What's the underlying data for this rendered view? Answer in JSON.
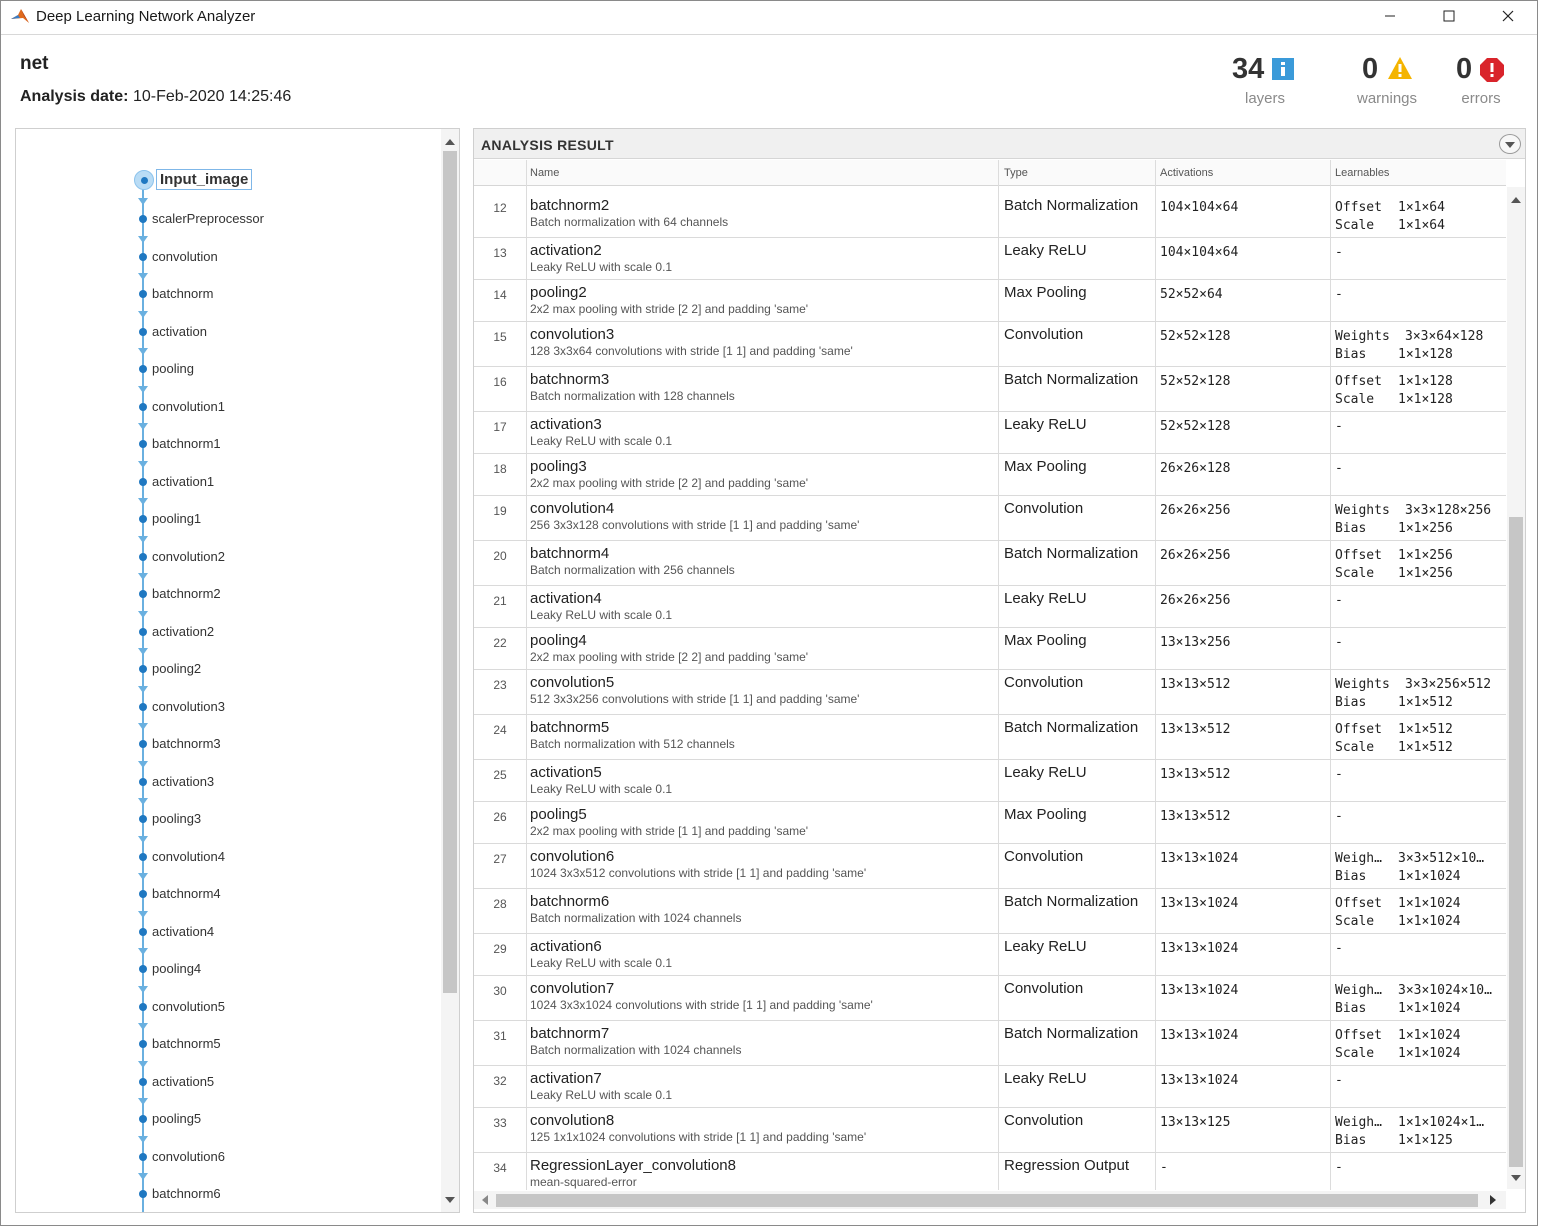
{
  "window": {
    "title": "Deep Learning Network Analyzer",
    "accent": "#1f78c1"
  },
  "header": {
    "network_name": "net",
    "analysis_date_label": "Analysis date:",
    "analysis_date_value": "10-Feb-2020 14:25:46",
    "layers_count": "34",
    "layers_label": "layers",
    "warnings_count": "0",
    "warnings_label": "warnings",
    "errors_count": "0",
    "errors_label": "errors"
  },
  "graph": {
    "root": "Input_image",
    "nodes": [
      "scalerPreprocessor",
      "convolution",
      "batchnorm",
      "activation",
      "pooling",
      "convolution1",
      "batchnorm1",
      "activation1",
      "pooling1",
      "convolution2",
      "batchnorm2",
      "activation2",
      "pooling2",
      "convolution3",
      "batchnorm3",
      "activation3",
      "pooling3",
      "convolution4",
      "batchnorm4",
      "activation4",
      "pooling4",
      "convolution5",
      "batchnorm5",
      "activation5",
      "pooling5",
      "convolution6",
      "batchnorm6"
    ]
  },
  "results": {
    "title": "ANALYSIS RESULT",
    "columns": {
      "name": "Name",
      "type": "Type",
      "activations": "Activations",
      "learnables": "Learnables"
    },
    "rows": [
      {
        "n": "12",
        "name": "batchnorm2",
        "desc": "Batch normalization with 64 channels",
        "type": "Batch Normalization",
        "act": "104×104×64",
        "learn": [
          [
            "Offset",
            "1×1×64"
          ],
          [
            "Scale",
            "1×1×64"
          ]
        ]
      },
      {
        "n": "13",
        "name": "activation2",
        "desc": "Leaky ReLU with scale 0.1",
        "type": "Leaky ReLU",
        "act": "104×104×64",
        "learn": [
          [
            "-",
            ""
          ]
        ]
      },
      {
        "n": "14",
        "name": "pooling2",
        "desc": "2x2 max pooling with stride [2 2] and padding 'same'",
        "type": "Max Pooling",
        "act": "52×52×64",
        "learn": [
          [
            "-",
            ""
          ]
        ]
      },
      {
        "n": "15",
        "name": "convolution3",
        "desc": "128 3x3x64 convolutions with stride [1 1] and padding 'same'",
        "type": "Convolution",
        "act": "52×52×128",
        "learn": [
          [
            "Weights",
            "3×3×64×128"
          ],
          [
            "Bias",
            "1×1×128"
          ]
        ]
      },
      {
        "n": "16",
        "name": "batchnorm3",
        "desc": "Batch normalization with 128 channels",
        "type": "Batch Normalization",
        "act": "52×52×128",
        "learn": [
          [
            "Offset",
            "1×1×128"
          ],
          [
            "Scale",
            "1×1×128"
          ]
        ]
      },
      {
        "n": "17",
        "name": "activation3",
        "desc": "Leaky ReLU with scale 0.1",
        "type": "Leaky ReLU",
        "act": "52×52×128",
        "learn": [
          [
            "-",
            ""
          ]
        ]
      },
      {
        "n": "18",
        "name": "pooling3",
        "desc": "2x2 max pooling with stride [2 2] and padding 'same'",
        "type": "Max Pooling",
        "act": "26×26×128",
        "learn": [
          [
            "-",
            ""
          ]
        ]
      },
      {
        "n": "19",
        "name": "convolution4",
        "desc": "256 3x3x128 convolutions with stride [1 1] and padding 'same'",
        "type": "Convolution",
        "act": "26×26×256",
        "learn": [
          [
            "Weights",
            "3×3×128×256"
          ],
          [
            "Bias",
            "1×1×256"
          ]
        ]
      },
      {
        "n": "20",
        "name": "batchnorm4",
        "desc": "Batch normalization with 256 channels",
        "type": "Batch Normalization",
        "act": "26×26×256",
        "learn": [
          [
            "Offset",
            "1×1×256"
          ],
          [
            "Scale",
            "1×1×256"
          ]
        ]
      },
      {
        "n": "21",
        "name": "activation4",
        "desc": "Leaky ReLU with scale 0.1",
        "type": "Leaky ReLU",
        "act": "26×26×256",
        "learn": [
          [
            "-",
            ""
          ]
        ]
      },
      {
        "n": "22",
        "name": "pooling4",
        "desc": "2x2 max pooling with stride [2 2] and padding 'same'",
        "type": "Max Pooling",
        "act": "13×13×256",
        "learn": [
          [
            "-",
            ""
          ]
        ]
      },
      {
        "n": "23",
        "name": "convolution5",
        "desc": "512 3x3x256 convolutions with stride [1 1] and padding 'same'",
        "type": "Convolution",
        "act": "13×13×512",
        "learn": [
          [
            "Weights",
            "3×3×256×512"
          ],
          [
            "Bias",
            "1×1×512"
          ]
        ]
      },
      {
        "n": "24",
        "name": "batchnorm5",
        "desc": "Batch normalization with 512 channels",
        "type": "Batch Normalization",
        "act": "13×13×512",
        "learn": [
          [
            "Offset",
            "1×1×512"
          ],
          [
            "Scale",
            "1×1×512"
          ]
        ]
      },
      {
        "n": "25",
        "name": "activation5",
        "desc": "Leaky ReLU with scale 0.1",
        "type": "Leaky ReLU",
        "act": "13×13×512",
        "learn": [
          [
            "-",
            ""
          ]
        ]
      },
      {
        "n": "26",
        "name": "pooling5",
        "desc": "2x2 max pooling with stride [1 1] and padding 'same'",
        "type": "Max Pooling",
        "act": "13×13×512",
        "learn": [
          [
            "-",
            ""
          ]
        ]
      },
      {
        "n": "27",
        "name": "convolution6",
        "desc": "1024 3x3x512 convolutions with stride [1 1] and padding 'same'",
        "type": "Convolution",
        "act": "13×13×1024",
        "learn": [
          [
            "Weigh…",
            "3×3×512×10…"
          ],
          [
            "Bias",
            "1×1×1024"
          ]
        ]
      },
      {
        "n": "28",
        "name": "batchnorm6",
        "desc": "Batch normalization with 1024 channels",
        "type": "Batch Normalization",
        "act": "13×13×1024",
        "learn": [
          [
            "Offset",
            "1×1×1024"
          ],
          [
            "Scale",
            "1×1×1024"
          ]
        ]
      },
      {
        "n": "29",
        "name": "activation6",
        "desc": "Leaky ReLU with scale 0.1",
        "type": "Leaky ReLU",
        "act": "13×13×1024",
        "learn": [
          [
            "-",
            ""
          ]
        ]
      },
      {
        "n": "30",
        "name": "convolution7",
        "desc": "1024 3x3x1024 convolutions with stride [1 1] and padding 'same'",
        "type": "Convolution",
        "act": "13×13×1024",
        "learn": [
          [
            "Weigh…",
            "3×3×1024×10…"
          ],
          [
            "Bias",
            "1×1×1024"
          ]
        ]
      },
      {
        "n": "31",
        "name": "batchnorm7",
        "desc": "Batch normalization with 1024 channels",
        "type": "Batch Normalization",
        "act": "13×13×1024",
        "learn": [
          [
            "Offset",
            "1×1×1024"
          ],
          [
            "Scale",
            "1×1×1024"
          ]
        ]
      },
      {
        "n": "32",
        "name": "activation7",
        "desc": "Leaky ReLU with scale 0.1",
        "type": "Leaky ReLU",
        "act": "13×13×1024",
        "learn": [
          [
            "-",
            ""
          ]
        ]
      },
      {
        "n": "33",
        "name": "convolution8",
        "desc": "125 1x1x1024 convolutions with stride [1 1] and padding 'same'",
        "type": "Convolution",
        "act": "13×13×125",
        "learn": [
          [
            "Weigh…",
            "1×1×1024×1…"
          ],
          [
            "Bias",
            "1×1×125"
          ]
        ]
      },
      {
        "n": "34",
        "name": "RegressionLayer_convolution8",
        "desc": "mean-squared-error",
        "type": "Regression Output",
        "act": "-",
        "learn": [
          [
            "-",
            ""
          ]
        ]
      }
    ]
  }
}
